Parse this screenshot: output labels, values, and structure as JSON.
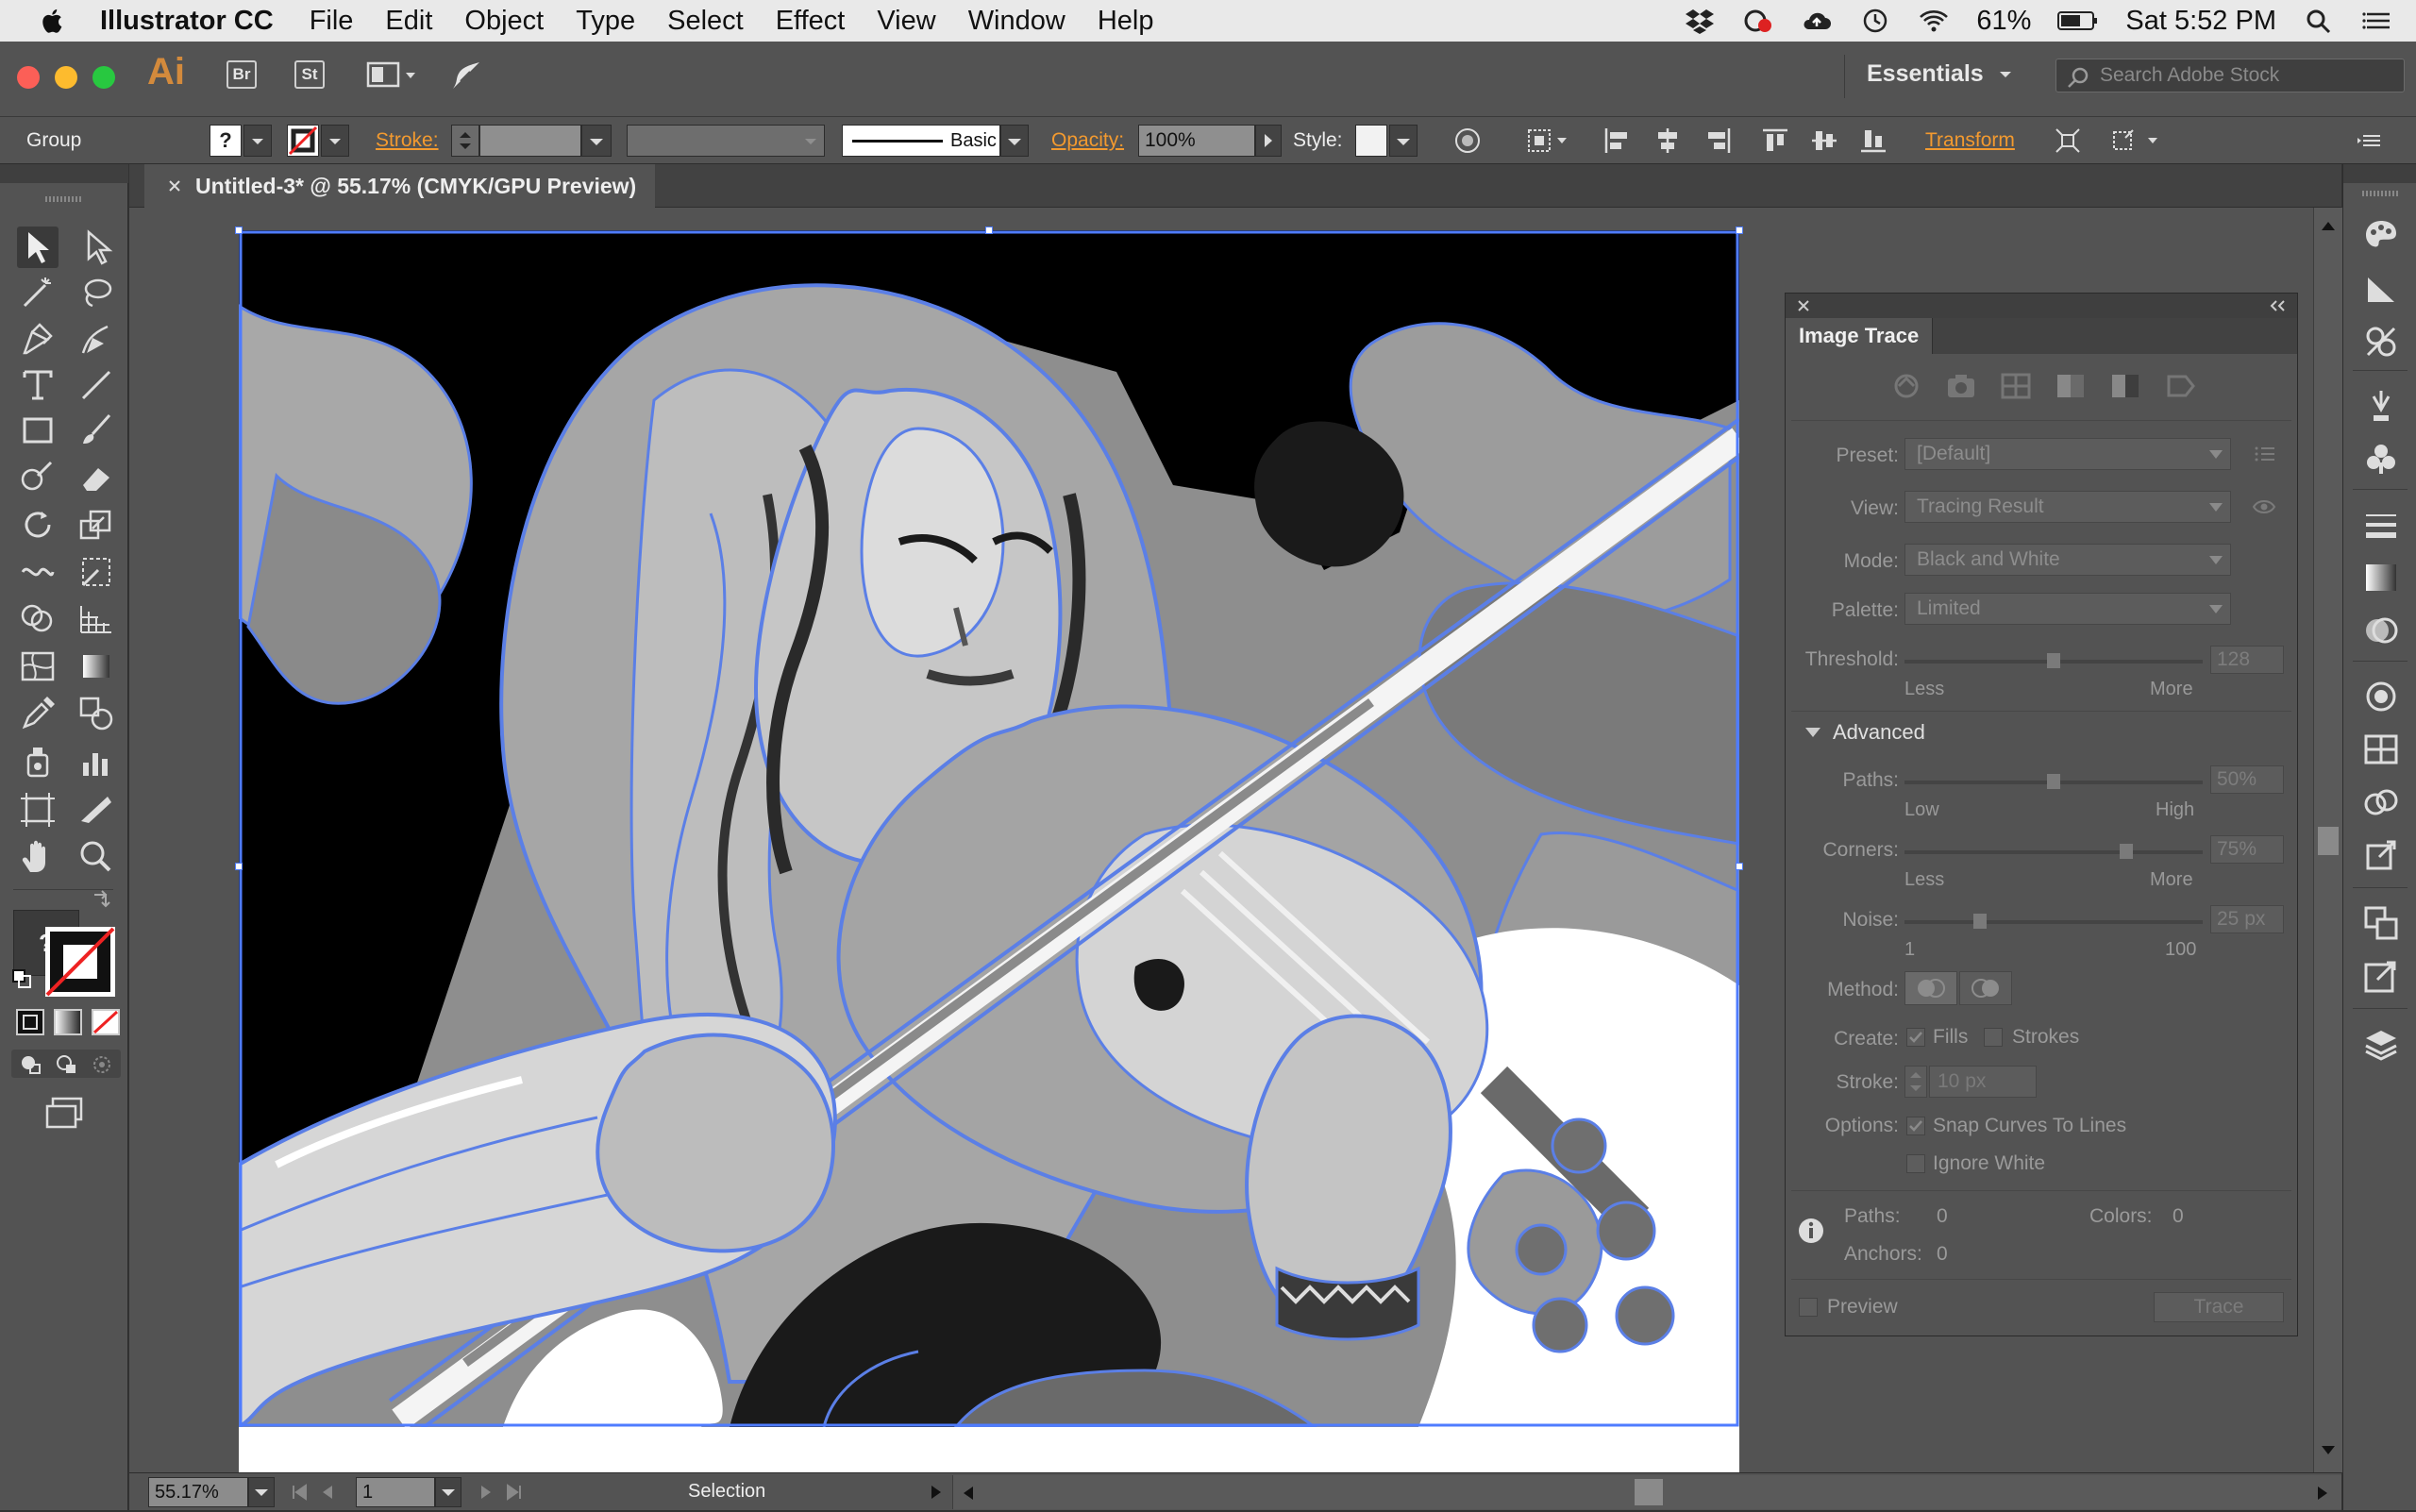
{
  "menubar": {
    "app_name": "Illustrator CC",
    "items": [
      "File",
      "Edit",
      "Object",
      "Type",
      "Select",
      "Effect",
      "View",
      "Window",
      "Help"
    ],
    "battery": "61%",
    "clock": "Sat 5:52 PM"
  },
  "appbar": {
    "logo": "Ai",
    "bridge": "Br",
    "stock": "St",
    "workspace": "Essentials",
    "search_placeholder": "Search Adobe Stock"
  },
  "controlbar": {
    "selection": "Group",
    "fill_unknown": "?",
    "stroke_label": "Stroke:",
    "brush_label": "Basic",
    "opacity_label": "Opacity:",
    "opacity_value": "100%",
    "style_label": "Style:",
    "transform_label": "Transform"
  },
  "document": {
    "tab_title": "Untitled-3* @ 55.17% (CMYK/GPU Preview)"
  },
  "statusbar": {
    "zoom": "55.17%",
    "artboard": "1",
    "tool": "Selection"
  },
  "image_trace": {
    "title": "Image Trace",
    "preset_label": "Preset:",
    "preset_value": "[Default]",
    "view_label": "View:",
    "view_value": "Tracing Result",
    "mode_label": "Mode:",
    "mode_value": "Black and White",
    "palette_label": "Palette:",
    "palette_value": "Limited",
    "threshold_label": "Threshold:",
    "threshold_value": "128",
    "threshold_min": "Less",
    "threshold_max": "More",
    "threshold_level": 0.5,
    "advanced_label": "Advanced",
    "paths_label": "Paths:",
    "paths_value": "50%",
    "paths_min": "Low",
    "paths_max": "High",
    "corners_label": "Corners:",
    "corners_value": "75%",
    "corners_min": "Less",
    "corners_max": "More",
    "noise_label": "Noise:",
    "noise_value": "25 px",
    "noise_min": "1",
    "noise_max": "100",
    "method_label": "Method:",
    "create_label": "Create:",
    "fills_label": "Fills",
    "strokes_label": "Strokes",
    "stroke_label": "Stroke:",
    "stroke_value": "10 px",
    "options_label": "Options:",
    "snap_label": "Snap Curves To Lines",
    "ignore_white_label": "Ignore White",
    "info_paths_label": "Paths:",
    "info_paths_value": "0",
    "info_colors_label": "Colors:",
    "info_colors_value": "0",
    "info_anchors_label": "Anchors:",
    "info_anchors_value": "0",
    "preview_label": "Preview",
    "trace_button": "Trace"
  },
  "colors": {
    "accent_orange": "#f39a2f",
    "selection_blue": "#4f7cff",
    "panel_bg": "#535353"
  }
}
